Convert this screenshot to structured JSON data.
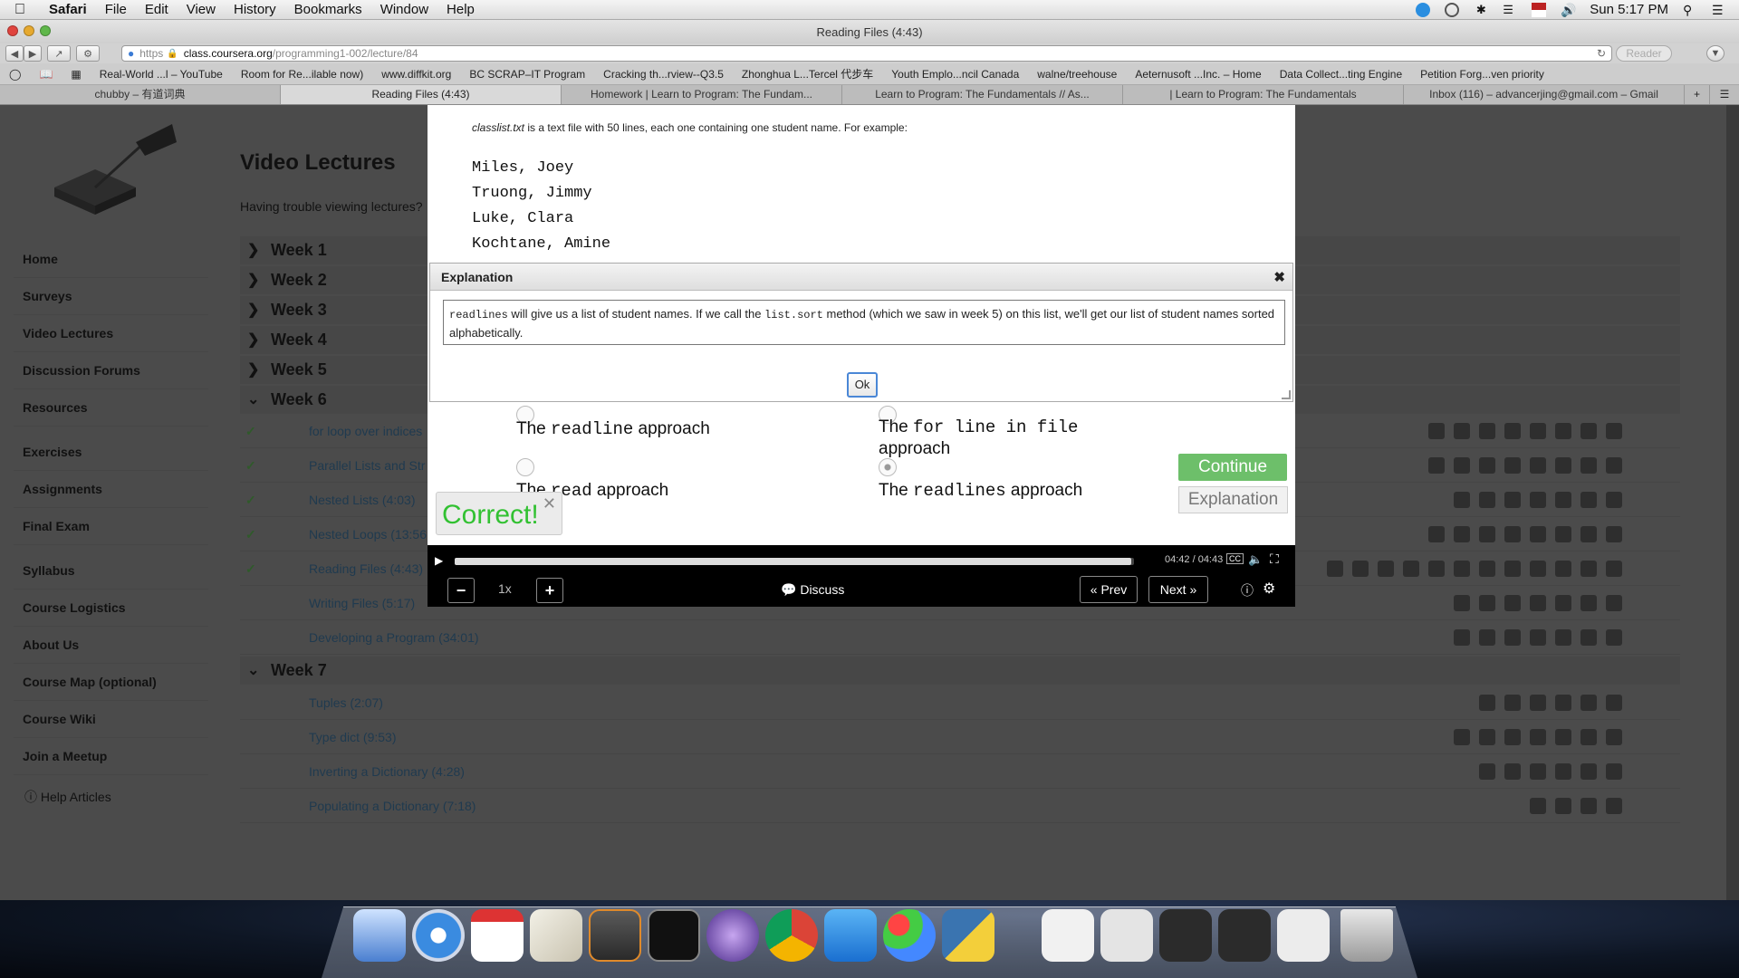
{
  "menubar": {
    "app": "Safari",
    "items": [
      "File",
      "Edit",
      "View",
      "History",
      "Bookmarks",
      "Window",
      "Help"
    ],
    "clock": "Sun 5:17 PM"
  },
  "window": {
    "title": "Reading Files (4:43)"
  },
  "address": {
    "scheme": "https",
    "host": "class.coursera.org",
    "path": "/programming1-002/lecture/84",
    "reader": "Reader"
  },
  "bookmarks": [
    "Real-World ...l – YouTube",
    "Room for Re...ilable now)",
    "www.diffkit.org",
    "BC SCRAP–IT Program",
    "Cracking th...rview--Q3.5",
    "Zhonghua L...Tercel 代步车",
    "Youth Emplo...ncil Canada",
    "walne/treehouse",
    "Aeternusoft ...Inc. – Home",
    "Data Collect...ting Engine",
    "Petition Forg...ven priority"
  ],
  "tabs": [
    "chubby – 有道词典",
    "Reading Files (4:43)",
    "Homework | Learn to Program: The Fundam...",
    "Learn to Program: The Fundamentals // As...",
    "| Learn to Program: The Fundamentals",
    "Inbox (116) – advancerjing@gmail.com – Gmail"
  ],
  "sidebar": {
    "items": [
      "Home",
      "Surveys",
      "Video Lectures",
      "Discussion Forums",
      "Resources",
      "Exercises",
      "Assignments",
      "Final Exam",
      "Syllabus",
      "Course Logistics",
      "About Us",
      "Course Map (optional)",
      "Course Wiki",
      "Join a Meetup"
    ],
    "help": "Help Articles"
  },
  "main": {
    "title": "Video Lectures",
    "trouble": "Having trouble viewing lectures?",
    "weeks": [
      "Week 1",
      "Week 2",
      "Week 3",
      "Week 4",
      "Week 5",
      "Week 6",
      "Week 7"
    ],
    "week6_lectures": [
      "for loop over indices",
      "Parallel Lists and Str",
      "Nested Lists (4:03)",
      "Nested Loops (13:56",
      "Reading Files (4:43)",
      "Writing Files (5:17)",
      "Developing a Program (34:01)"
    ],
    "week7_lectures": [
      "Tuples (2:07)",
      "Type dict (9:53)",
      "Inverting a Dictionary (4:28)",
      "Populating a Dictionary (7:18)"
    ]
  },
  "slide": {
    "intro_file": "classlist.txt",
    "intro_rest": " is a text file with 50 lines, each one containing one student name. For example:",
    "names": [
      "Miles, Joey",
      "Truong, Jimmy",
      "Luke, Clara",
      "Kochtane, Amine"
    ]
  },
  "explanation": {
    "header": "Explanation",
    "code1": "readlines",
    "text1": " will give us a list of student names. If we call the ",
    "code2": "list.sort",
    "text2": " method (which we saw in week 5) on this list, we'll get our list of student names sorted alphabetically.",
    "ok": "Ok"
  },
  "quiz": {
    "opt1_pre": "The ",
    "opt1_code": "readline",
    "opt1_post": " approach",
    "opt2_pre": "The ",
    "opt2_code": "for line in file",
    "opt2_post": "approach",
    "opt3_pre": "The ",
    "opt3_code": "read",
    "opt3_post": " approach",
    "opt4_pre": "The ",
    "opt4_code": "readlines",
    "opt4_post": " approach",
    "continue": "Continue",
    "explanation": "Explanation",
    "correct": "Correct!"
  },
  "player": {
    "time": "04:42 / 04:43",
    "progress": 0.996,
    "speed": "1x",
    "discuss": "Discuss",
    "prev": "« Prev",
    "next": "Next »"
  },
  "colors": {
    "accent_green": "#6dbf6a",
    "correct_green": "#32c132"
  }
}
